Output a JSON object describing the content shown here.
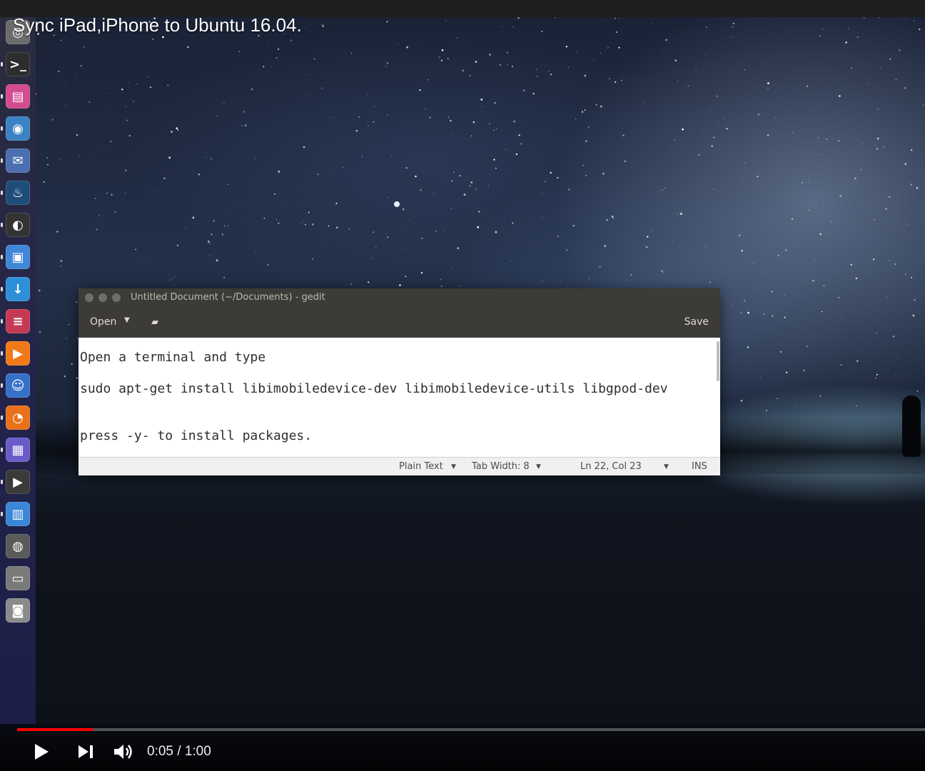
{
  "video": {
    "title": "Sync iPad,iPhone to Ubuntu 16.04.",
    "time_current": "0:05",
    "time_separator": " / ",
    "time_total": "1:00",
    "progress_fraction": 0.083
  },
  "launcher": {
    "items": [
      {
        "name": "dash",
        "color": "#6b6b6b",
        "glyph": "◎"
      },
      {
        "name": "terminal",
        "color": "#2d2d2d",
        "glyph": ">_"
      },
      {
        "name": "files",
        "color": "#d24c8f",
        "glyph": "▤"
      },
      {
        "name": "chrome",
        "color": "#3b82c4",
        "glyph": "◉"
      },
      {
        "name": "mail",
        "color": "#4b6fb0",
        "glyph": "✉"
      },
      {
        "name": "steam",
        "color": "#1f4d7a",
        "glyph": "♨"
      },
      {
        "name": "obs",
        "color": "#333333",
        "glyph": "◐"
      },
      {
        "name": "camera",
        "color": "#3f86d8",
        "glyph": "▣"
      },
      {
        "name": "downloader",
        "color": "#2d8fd8",
        "glyph": "↓"
      },
      {
        "name": "settings",
        "color": "#c43a54",
        "glyph": "≡"
      },
      {
        "name": "media-player",
        "color": "#f07a1a",
        "glyph": "▶"
      },
      {
        "name": "chat",
        "color": "#3571c9",
        "glyph": "☺"
      },
      {
        "name": "blender",
        "color": "#e8711a",
        "glyph": "◔"
      },
      {
        "name": "notes",
        "color": "#6b5bc9",
        "glyph": "▦"
      },
      {
        "name": "video-player",
        "color": "#3a3a3a",
        "glyph": "▶"
      },
      {
        "name": "file-manager",
        "color": "#3a86d8",
        "glyph": "▥"
      },
      {
        "name": "webcam",
        "color": "#5a5a5a",
        "glyph": "◍"
      },
      {
        "name": "display",
        "color": "#7a7a7a",
        "glyph": "▭"
      },
      {
        "name": "screenshot",
        "color": "#8a8a8a",
        "glyph": "◙"
      }
    ]
  },
  "gedit": {
    "window_title": "Untitled Document (~/Documents) - gedit",
    "open_label": "Open",
    "save_label": "Save",
    "lines": [
      "Open a terminal and type",
      "sudo apt-get install libimobiledevice-dev libimobiledevice-utils libgpod-dev",
      "press -y- to install packages."
    ],
    "status": {
      "language": "Plain Text",
      "tab_width": "Tab Width: 8",
      "position": "Ln 22, Col 23",
      "mode": "INS"
    }
  }
}
